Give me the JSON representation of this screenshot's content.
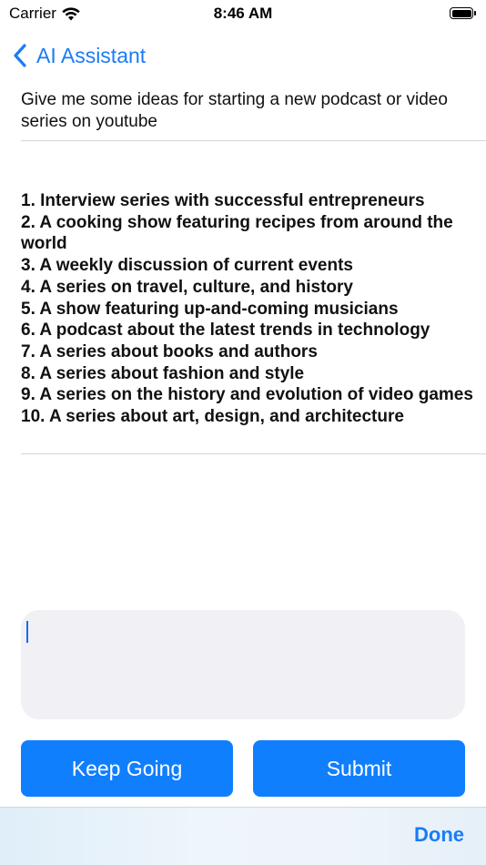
{
  "status_bar": {
    "carrier": "Carrier",
    "time": "8:46 AM"
  },
  "nav": {
    "back_label": "AI Assistant"
  },
  "prompt": {
    "text": "Give me some ideas for starting a new podcast or video series on youtube"
  },
  "response": {
    "items": [
      "1. Interview series with successful entrepreneurs",
      "2. A cooking show featuring recipes from around the world",
      "3. A weekly discussion of current events",
      "4. A series on travel, culture, and history",
      "5. A show featuring up-and-coming musicians",
      "6. A podcast about the latest trends in technology",
      "7. A series about books and authors",
      "8. A series about fashion and style",
      "9. A series on the history and evolution of video games",
      "10. A series about art, design, and architecture"
    ]
  },
  "input": {
    "value": ""
  },
  "buttons": {
    "keep_going": "Keep Going",
    "submit": "Submit"
  },
  "toolbar": {
    "done": "Done"
  },
  "colors": {
    "accent": "#107ffe",
    "link": "#1a7cf5",
    "input_bg": "#f0f0f5"
  }
}
